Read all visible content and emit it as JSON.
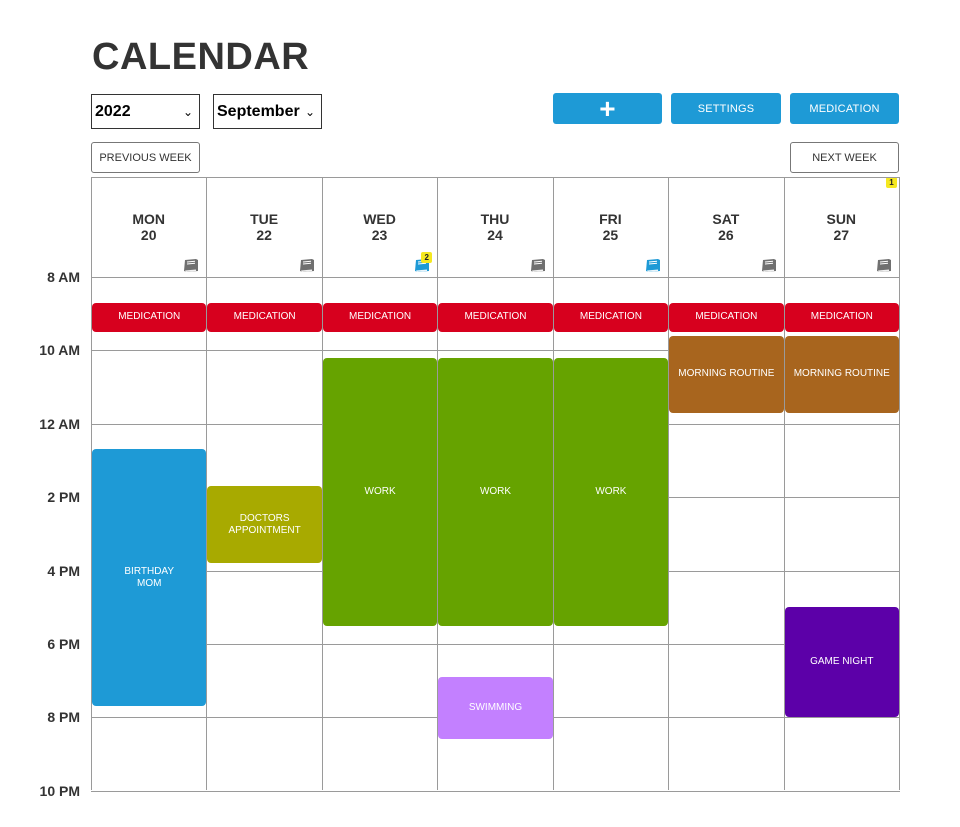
{
  "title": "CALENDAR",
  "controls": {
    "year": "2022",
    "month": "September",
    "add_label": "+",
    "settings_label": "SETTINGS",
    "medication_label": "MEDICATION",
    "prev_week_label": "PREVIOUS WEEK",
    "next_week_label": "NEXT WEEK",
    "next_week_badge": "1"
  },
  "colors": {
    "accent": "#1e9ad6",
    "medication": "#d7001e",
    "work": "#66a300",
    "birthday": "#1e9ad6",
    "appointment": "#a8aa00",
    "routine": "#a8651e",
    "swimming": "#c380ff",
    "game": "#5c00a8"
  },
  "days": [
    {
      "name": "MON",
      "date": "20",
      "book": "gray-book-icon",
      "badge": ""
    },
    {
      "name": "TUE",
      "date": "22",
      "book": "gray-book-icon",
      "badge": ""
    },
    {
      "name": "WED",
      "date": "23",
      "book": "blue-book-icon",
      "badge": "2"
    },
    {
      "name": "THU",
      "date": "24",
      "book": "gray-book-icon",
      "badge": ""
    },
    {
      "name": "FRI",
      "date": "25",
      "book": "blue-book-icon",
      "badge": ""
    },
    {
      "name": "SAT",
      "date": "26",
      "book": "gray-book-icon",
      "badge": ""
    },
    {
      "name": "SUN",
      "date": "27",
      "book": "gray-book-icon",
      "badge": ""
    }
  ],
  "time_labels": [
    "8 AM",
    "10 AM",
    "12 AM",
    "2 PM",
    "4 PM",
    "6 PM",
    "8 PM",
    "10 PM"
  ],
  "events": [
    {
      "name": "medication-event-mon",
      "label": "MEDICATION",
      "day": 0,
      "start": 8.7,
      "end": 9.5,
      "color": "#d7001e"
    },
    {
      "name": "medication-event-tue",
      "label": "MEDICATION",
      "day": 1,
      "start": 8.7,
      "end": 9.5,
      "color": "#d7001e"
    },
    {
      "name": "medication-event-wed",
      "label": "MEDICATION",
      "day": 2,
      "start": 8.7,
      "end": 9.5,
      "color": "#d7001e"
    },
    {
      "name": "medication-event-thu",
      "label": "MEDICATION",
      "day": 3,
      "start": 8.7,
      "end": 9.5,
      "color": "#d7001e"
    },
    {
      "name": "medication-event-fri",
      "label": "MEDICATION",
      "day": 4,
      "start": 8.7,
      "end": 9.5,
      "color": "#d7001e"
    },
    {
      "name": "medication-event-sat",
      "label": "MEDICATION",
      "day": 5,
      "start": 8.7,
      "end": 9.5,
      "color": "#d7001e"
    },
    {
      "name": "medication-event-sun",
      "label": "MEDICATION",
      "day": 6,
      "start": 8.7,
      "end": 9.5,
      "color": "#d7001e"
    },
    {
      "name": "morning-routine-event-sat",
      "label": "MORNING ROUTINE",
      "day": 5,
      "start": 9.6,
      "end": 11.7,
      "color": "#a8651e"
    },
    {
      "name": "morning-routine-event-sun",
      "label": "MORNING ROUTINE",
      "day": 6,
      "start": 9.6,
      "end": 11.7,
      "color": "#a8651e"
    },
    {
      "name": "work-event-wed",
      "label": "WORK",
      "day": 2,
      "start": 10.2,
      "end": 17.5,
      "color": "#66a300"
    },
    {
      "name": "work-event-thu",
      "label": "WORK",
      "day": 3,
      "start": 10.2,
      "end": 17.5,
      "color": "#66a300"
    },
    {
      "name": "work-event-fri",
      "label": "WORK",
      "day": 4,
      "start": 10.2,
      "end": 17.5,
      "color": "#66a300"
    },
    {
      "name": "birthday-mom-event",
      "label": "BIRTHDAY\nMOM",
      "day": 0,
      "start": 12.7,
      "end": 19.7,
      "color": "#1e9ad6"
    },
    {
      "name": "doctors-appointment-event",
      "label": "DOCTORS\nAPPOINTMENT",
      "day": 1,
      "start": 13.7,
      "end": 15.8,
      "color": "#a8aa00"
    },
    {
      "name": "game-night-event",
      "label": "GAME NIGHT",
      "day": 6,
      "start": 17.0,
      "end": 20.0,
      "color": "#5c00a8"
    },
    {
      "name": "swimming-event",
      "label": "SWIMMING",
      "day": 3,
      "start": 18.9,
      "end": 20.6,
      "color": "#c380ff"
    }
  ]
}
